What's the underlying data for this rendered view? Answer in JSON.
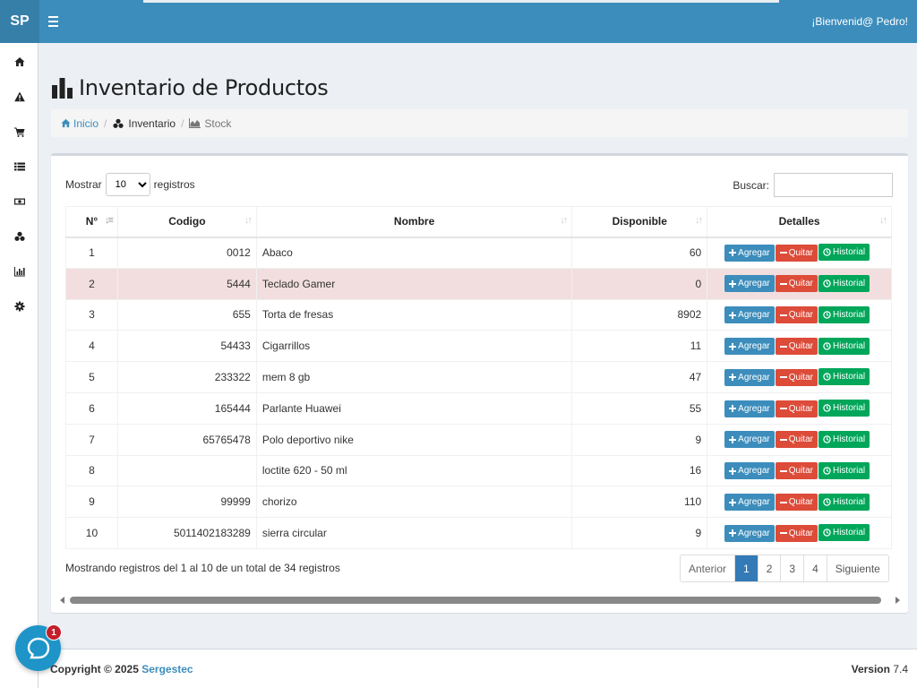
{
  "header": {
    "logo": "SP",
    "welcome": "¡Bienvenid@ Pedro!"
  },
  "sidebar": {
    "items": [
      {
        "icon": "home-icon"
      },
      {
        "icon": "warning-icon"
      },
      {
        "icon": "cart-icon"
      },
      {
        "icon": "list-icon"
      },
      {
        "icon": "money-icon"
      },
      {
        "icon": "cubes-icon"
      },
      {
        "icon": "bar-chart-icon"
      },
      {
        "icon": "gear-icon"
      }
    ]
  },
  "page": {
    "title": "Inventario de Productos"
  },
  "breadcrumb": {
    "home": "Inicio",
    "inventory": "Inventario",
    "stock": "Stock"
  },
  "table_controls": {
    "show_label": "Mostrar",
    "page_size": "10",
    "records_label": "registros",
    "search_label": "Buscar:"
  },
  "columns": [
    "N°",
    "Codigo",
    "Nombre",
    "Disponible",
    "Detalles"
  ],
  "rows": [
    {
      "n": "1",
      "codigo": "0012",
      "nombre": "Abaco",
      "disponible": "60"
    },
    {
      "n": "2",
      "codigo": "5444",
      "nombre": "Teclado Gamer",
      "disponible": "0"
    },
    {
      "n": "3",
      "codigo": "655",
      "nombre": "Torta de fresas",
      "disponible": "8902"
    },
    {
      "n": "4",
      "codigo": "54433",
      "nombre": "Cigarrillos",
      "disponible": "11"
    },
    {
      "n": "5",
      "codigo": "233322",
      "nombre": "mem 8 gb",
      "disponible": "47"
    },
    {
      "n": "6",
      "codigo": "165444",
      "nombre": "Parlante Huawei",
      "disponible": "55"
    },
    {
      "n": "7",
      "codigo": "65765478",
      "nombre": "Polo deportivo nike",
      "disponible": "9"
    },
    {
      "n": "8",
      "codigo": "",
      "nombre": "loctite 620 - 50 ml",
      "disponible": "16"
    },
    {
      "n": "9",
      "codigo": "99999",
      "nombre": "chorizo",
      "disponible": "110"
    },
    {
      "n": "10",
      "codigo": "5011402183289",
      "nombre": "sierra circular",
      "disponible": "9"
    }
  ],
  "actions": {
    "add": "Agregar",
    "remove": "Quitar",
    "history": "Historial"
  },
  "info": "Mostrando registros del 1 al 10 de un total de 34 registros",
  "pagination": {
    "prev": "Anterior",
    "pages": [
      "1",
      "2",
      "3",
      "4"
    ],
    "next": "Siguiente"
  },
  "footer": {
    "copyright": "Copyright © 2025",
    "company": "Sergestec",
    "version_label": "Version",
    "version": "7.4"
  },
  "chat": {
    "badge": "1"
  },
  "colors": {
    "primary": "#3c8dbc",
    "danger": "#dd4b39",
    "success": "#00a65a",
    "zero_row": "#f2dede"
  }
}
